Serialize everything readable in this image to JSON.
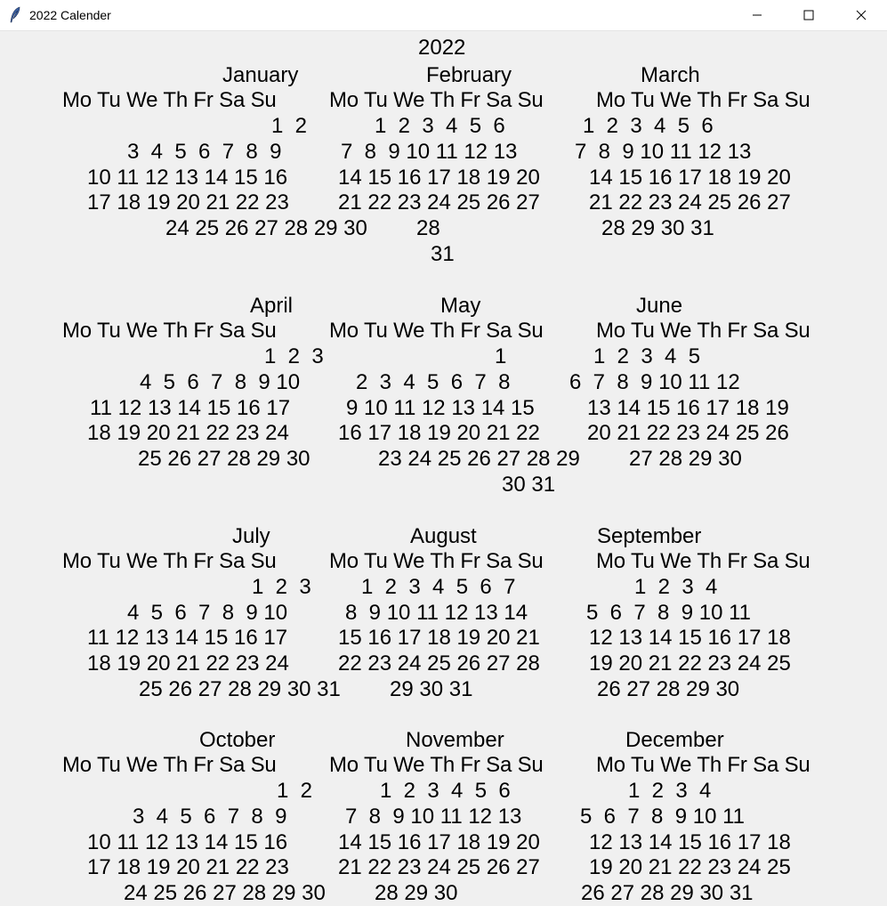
{
  "window": {
    "title": "2022 Calender",
    "icon": "feather-icon",
    "controls": [
      "minimize-icon",
      "maximize-icon",
      "close-icon"
    ]
  },
  "calendar": {
    "year": "2022",
    "day_header": "Mo Tu We Th Fr Sa Su",
    "months": [
      {
        "name": "January",
        "weeks": [
          "1  2",
          "3  4  5  6  7  8  9",
          "10 11 12 13 14 15 16",
          "17 18 19 20 21 22 23",
          "24 25 26 27 28 29 30",
          "31"
        ]
      },
      {
        "name": "February",
        "weeks": [
          "1  2  3  4  5  6",
          "7  8  9 10 11 12 13",
          "14 15 16 17 18 19 20",
          "21 22 23 24 25 26 27",
          "28"
        ]
      },
      {
        "name": "March",
        "weeks": [
          "1  2  3  4  5  6",
          "7  8  9 10 11 12 13",
          "14 15 16 17 18 19 20",
          "21 22 23 24 25 26 27",
          "28 29 30 31"
        ]
      },
      {
        "name": "April",
        "weeks": [
          "1  2  3",
          "4  5  6  7  8  9 10",
          "11 12 13 14 15 16 17",
          "18 19 20 21 22 23 24",
          "25 26 27 28 29 30"
        ]
      },
      {
        "name": "May",
        "weeks": [
          "1",
          "2  3  4  5  6  7  8",
          "9 10 11 12 13 14 15",
          "16 17 18 19 20 21 22",
          "23 24 25 26 27 28 29",
          "30 31"
        ]
      },
      {
        "name": "June",
        "weeks": [
          "1  2  3  4  5",
          "6  7  8  9 10 11 12",
          "13 14 15 16 17 18 19",
          "20 21 22 23 24 25 26",
          "27 28 29 30"
        ]
      },
      {
        "name": "July",
        "weeks": [
          "1  2  3",
          "4  5  6  7  8  9 10",
          "11 12 13 14 15 16 17",
          "18 19 20 21 22 23 24",
          "25 26 27 28 29 30 31"
        ]
      },
      {
        "name": "August",
        "weeks": [
          "1  2  3  4  5  6  7",
          "8  9 10 11 12 13 14",
          "15 16 17 18 19 20 21",
          "22 23 24 25 26 27 28",
          "29 30 31"
        ]
      },
      {
        "name": "September",
        "weeks": [
          "1  2  3  4",
          "5  6  7  8  9 10 11",
          "12 13 14 15 16 17 18",
          "19 20 21 22 23 24 25",
          "26 27 28 29 30"
        ]
      },
      {
        "name": "October",
        "weeks": [
          "1  2",
          "3  4  5  6  7  8  9",
          "10 11 12 13 14 15 16",
          "17 18 19 20 21 22 23",
          "24 25 26 27 28 29 30"
        ]
      },
      {
        "name": "November",
        "weeks": [
          "1  2  3  4  5  6",
          "7  8  9 10 11 12 13",
          "14 15 16 17 18 19 20",
          "21 22 23 24 25 26 27",
          "28 29 30"
        ]
      },
      {
        "name": "December",
        "weeks": [
          "1  2  3  4",
          "5  6  7  8  9 10 11",
          "12 13 14 15 16 17 18",
          "19 20 21 22 23 24 25",
          "26 27 28 29 30 31"
        ]
      }
    ]
  }
}
